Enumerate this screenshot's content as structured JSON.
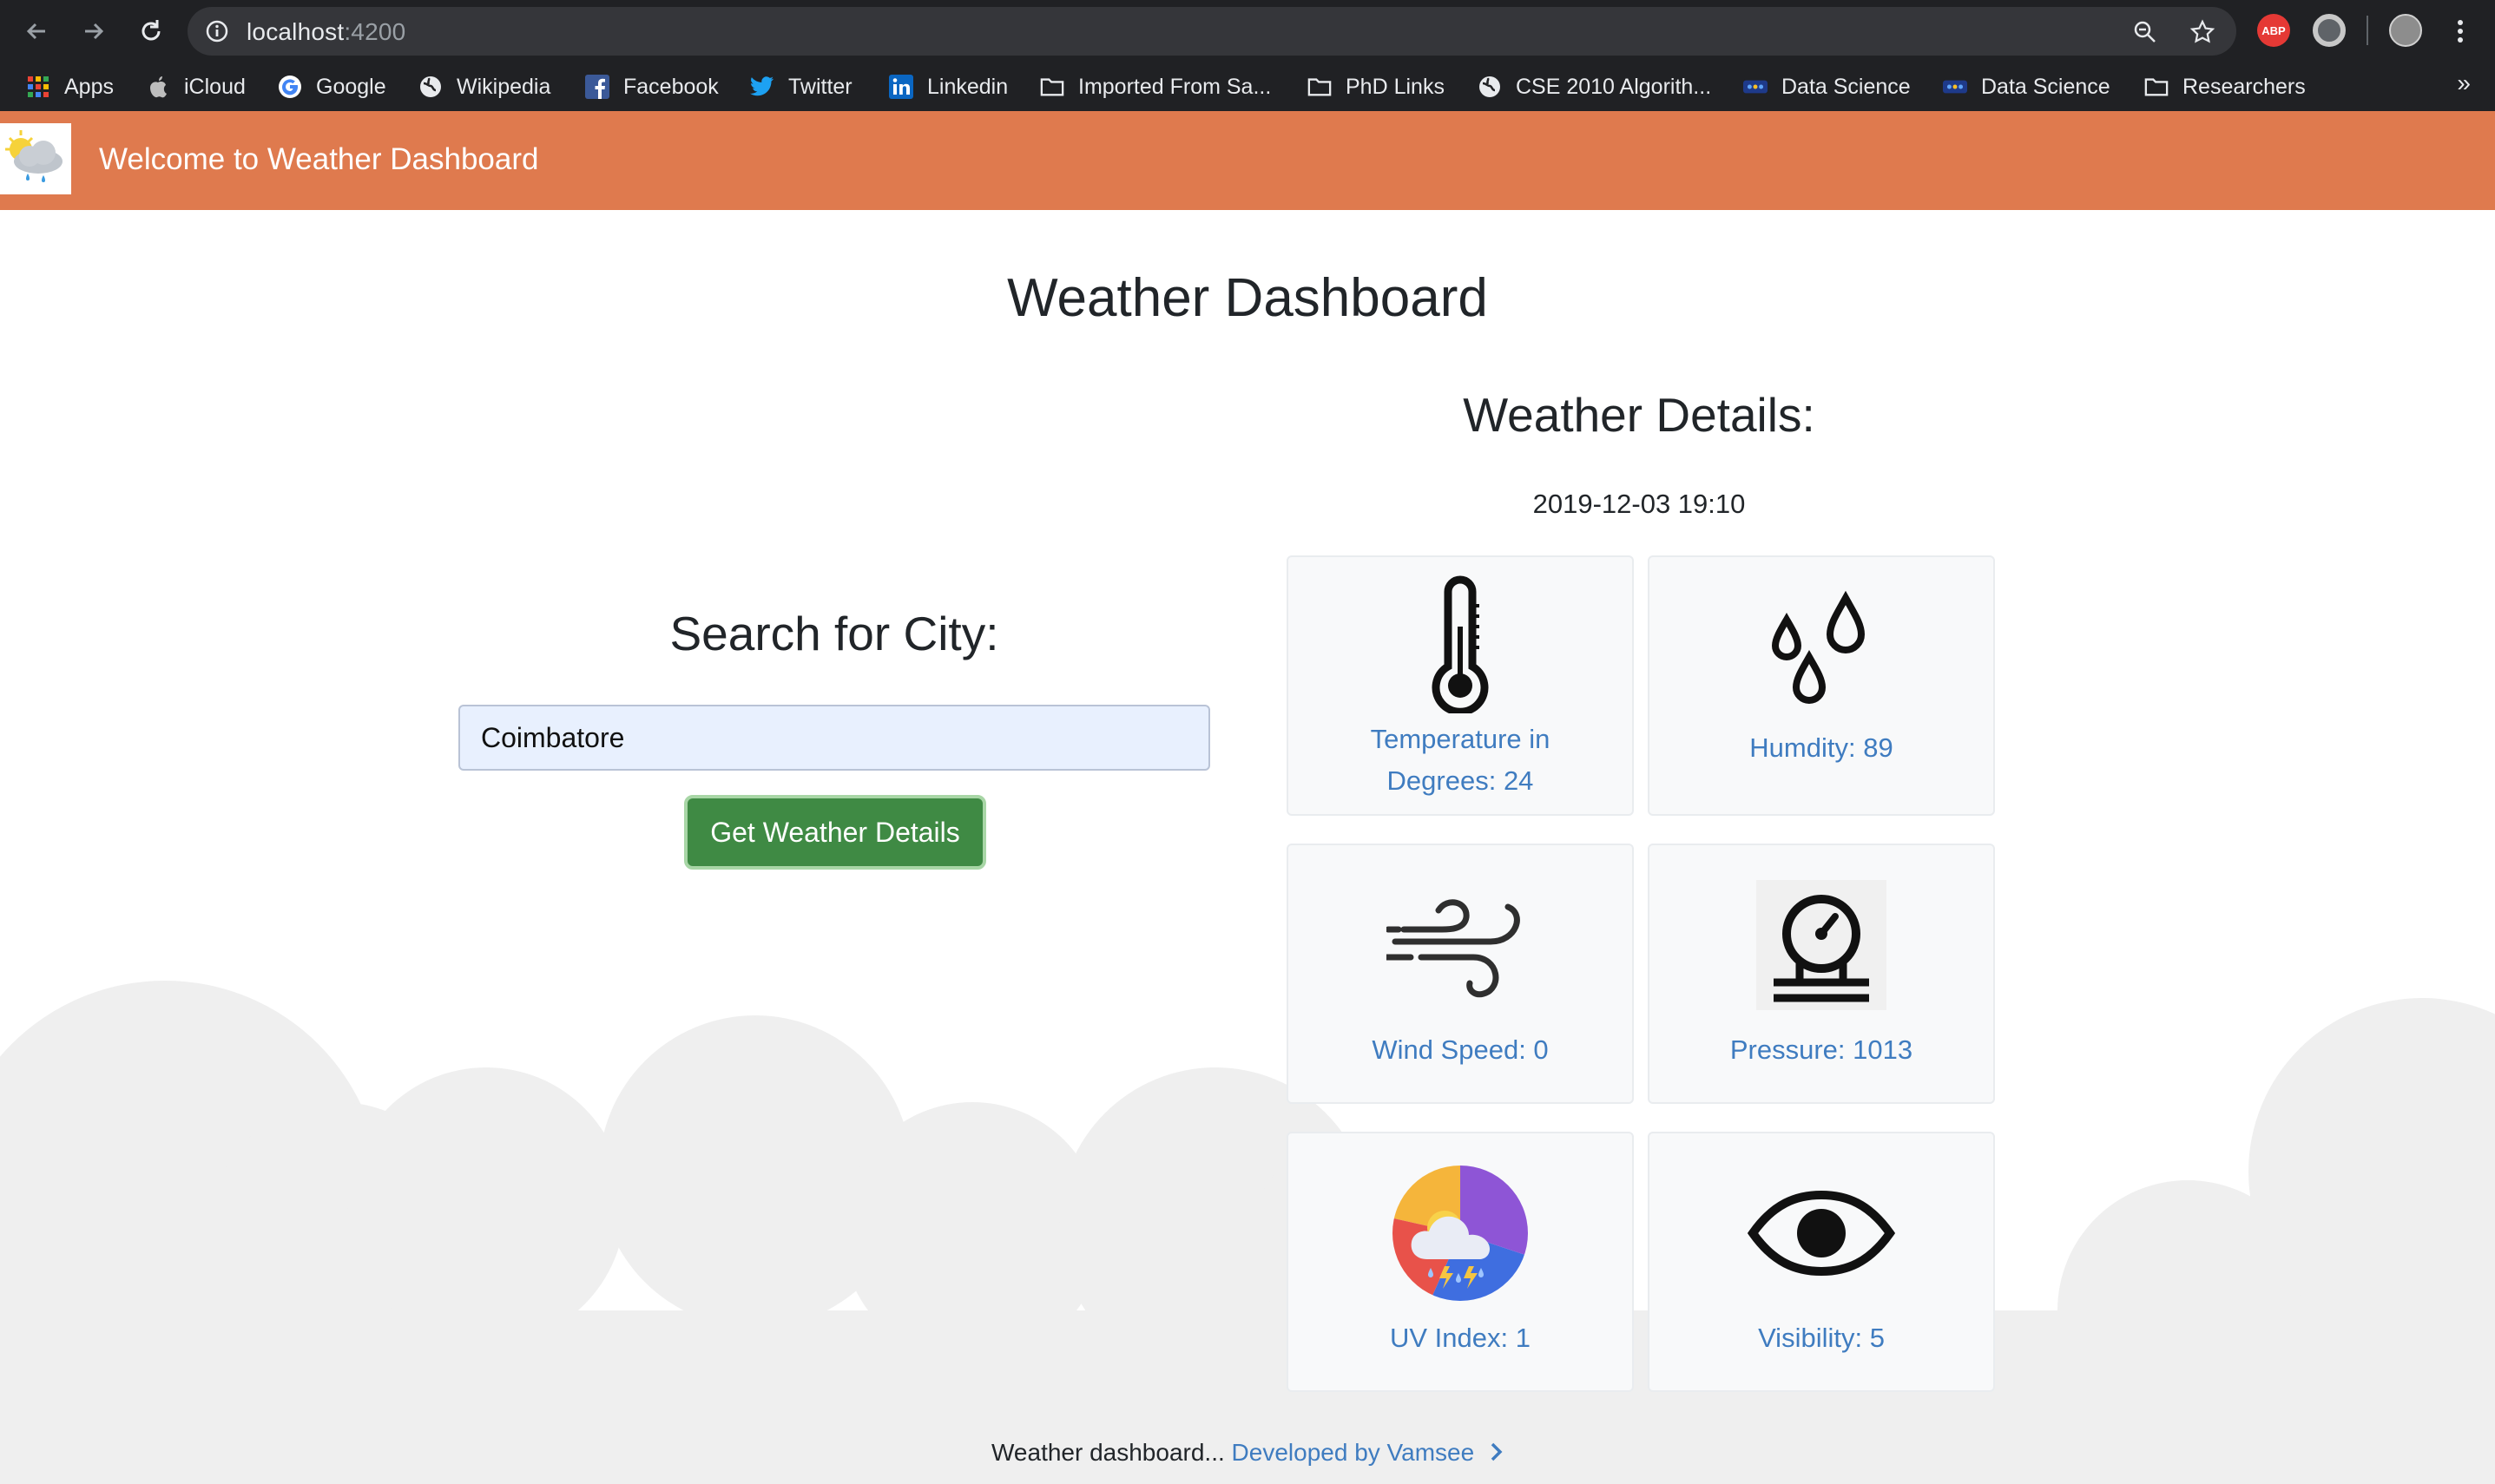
{
  "browser": {
    "url_host": "localhost",
    "url_port": ":4200",
    "ext_abp_label": "ABP",
    "bookmarks": [
      "Apps",
      "iCloud",
      "Google",
      "Wikipedia",
      "Facebook",
      "Twitter",
      "Linkedin",
      "Imported From Sa...",
      "PhD Links",
      "CSE 2010 Algorith...",
      "Data Science",
      "Data Science",
      "Researchers"
    ],
    "more_label": "»"
  },
  "header": {
    "brand": "Welcome to Weather Dashboard"
  },
  "main": {
    "title": "Weather Dashboard",
    "search_title": "Search for City:",
    "search_value": "Coimbatore",
    "search_button": "Get Weather Details",
    "details_title": "Weather Details:",
    "timestamp": "2019-12-03 19:10"
  },
  "cards": {
    "temperature_line1": "Temperature in",
    "temperature_line2": "Degrees: 24",
    "humidity": "Humdity: 89",
    "wind": "Wind Speed: 0",
    "pressure": "Pressure: 1013",
    "uv": "UV Index: 1",
    "visibility": "Visibility: 5"
  },
  "footer": {
    "text": "Weather dashboard...",
    "link": "Developed by Vamsee"
  },
  "colors": {
    "header_bg": "#df7a4e",
    "link_blue": "#3f7cc0",
    "button_green": "#3f8a44",
    "chrome_bg": "#202124"
  },
  "icons": [
    "back-arrow-icon",
    "forward-arrow-icon",
    "reload-icon",
    "info-icon",
    "zoom-icon",
    "star-icon",
    "thermometer-icon",
    "droplets-icon",
    "wind-icon",
    "gauge-icon",
    "uv-weather-icon",
    "eye-icon",
    "chevron-right-icon"
  ]
}
